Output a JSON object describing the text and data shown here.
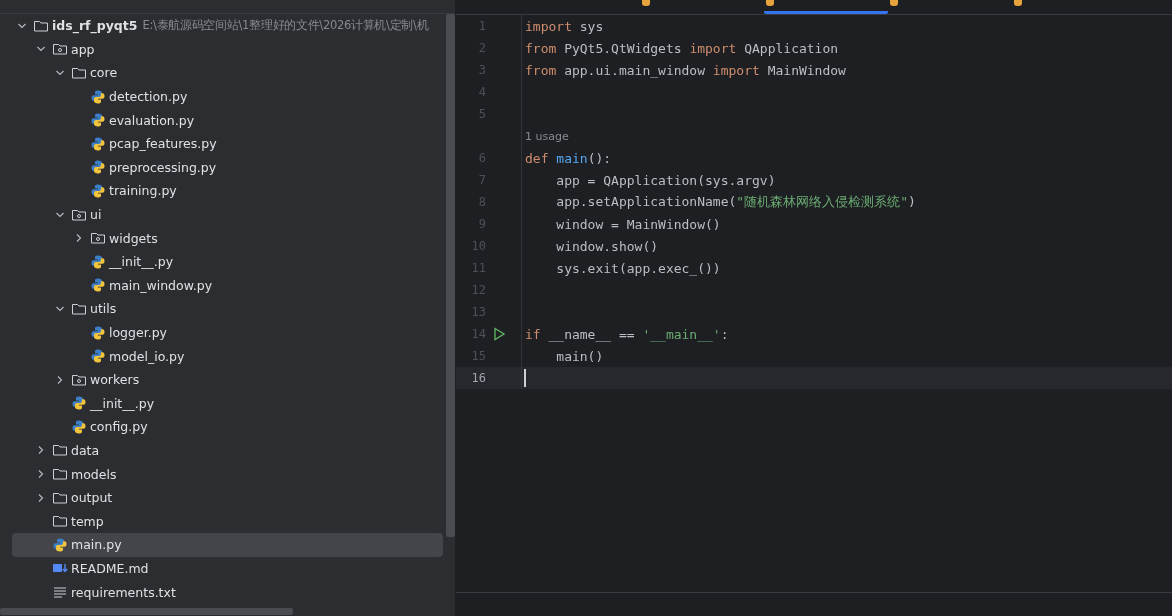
{
  "editor_tabs": [
    {
      "selected": false
    },
    {
      "selected": true
    },
    {
      "selected": false
    },
    {
      "selected": false
    }
  ],
  "project_tree": {
    "name": "ids_rf_pyqt5",
    "path": "E:\\泰航源码空间站\\1整理好的文件\\2026计算机\\定制\\机",
    "kind": "folder",
    "expanded": true,
    "selected": false,
    "children": [
      {
        "name": "app",
        "kind": "package",
        "expanded": true,
        "selected": false,
        "children": [
          {
            "name": "core",
            "kind": "folder",
            "expanded": true,
            "selected": false,
            "children": [
              {
                "name": "detection.py",
                "kind": "python",
                "selected": false
              },
              {
                "name": "evaluation.py",
                "kind": "python",
                "selected": false
              },
              {
                "name": "pcap_features.py",
                "kind": "python",
                "selected": false
              },
              {
                "name": "preprocessing.py",
                "kind": "python",
                "selected": false
              },
              {
                "name": "training.py",
                "kind": "python",
                "selected": false
              }
            ]
          },
          {
            "name": "ui",
            "kind": "package",
            "expanded": true,
            "selected": false,
            "children": [
              {
                "name": "widgets",
                "kind": "package",
                "expanded": false,
                "selected": false
              },
              {
                "name": "__init__.py",
                "kind": "python",
                "selected": false
              },
              {
                "name": "main_window.py",
                "kind": "python",
                "selected": false
              }
            ]
          },
          {
            "name": "utils",
            "kind": "folder",
            "expanded": true,
            "selected": false,
            "children": [
              {
                "name": "logger.py",
                "kind": "python",
                "selected": false
              },
              {
                "name": "model_io.py",
                "kind": "python",
                "selected": false
              }
            ]
          },
          {
            "name": "workers",
            "kind": "package",
            "expanded": false,
            "selected": false
          },
          {
            "name": "__init__.py",
            "kind": "python",
            "selected": false
          },
          {
            "name": "config.py",
            "kind": "python",
            "selected": false
          }
        ]
      },
      {
        "name": "data",
        "kind": "folder",
        "expanded": false,
        "selected": false
      },
      {
        "name": "models",
        "kind": "folder",
        "expanded": false,
        "selected": false
      },
      {
        "name": "output",
        "kind": "folder",
        "expanded": false,
        "selected": false
      },
      {
        "name": "temp",
        "kind": "folder",
        "selected": false
      },
      {
        "name": "main.py",
        "kind": "python",
        "selected": true
      },
      {
        "name": "README.md",
        "kind": "markdown",
        "selected": false
      },
      {
        "name": "requirements.txt",
        "kind": "text",
        "selected": false
      }
    ]
  },
  "editor_lines": [
    {
      "kind": "code",
      "number": "1",
      "current": false,
      "run": false,
      "tokens": [
        {
          "kind": "keyword",
          "text": "import"
        },
        {
          "kind": "plain",
          "text": " sys"
        }
      ]
    },
    {
      "kind": "code",
      "number": "2",
      "current": false,
      "run": false,
      "tokens": [
        {
          "kind": "keyword",
          "text": "from"
        },
        {
          "kind": "plain",
          "text": " PyQt5.QtWidgets "
        },
        {
          "kind": "keyword",
          "text": "import"
        },
        {
          "kind": "plain",
          "text": " QApplication"
        }
      ]
    },
    {
      "kind": "code",
      "number": "3",
      "current": false,
      "run": false,
      "tokens": [
        {
          "kind": "keyword",
          "text": "from"
        },
        {
          "kind": "plain",
          "text": " app.ui.main_window "
        },
        {
          "kind": "keyword",
          "text": "import"
        },
        {
          "kind": "plain",
          "text": " MainWindow"
        }
      ]
    },
    {
      "kind": "code",
      "number": "4",
      "current": false,
      "run": false
    },
    {
      "kind": "code",
      "number": "5",
      "current": false,
      "run": false
    },
    {
      "kind": "hint",
      "text": "1 usage"
    },
    {
      "kind": "code",
      "number": "6",
      "current": false,
      "run": false,
      "tokens": [
        {
          "kind": "keyword",
          "text": "def "
        },
        {
          "kind": "function",
          "text": "main"
        },
        {
          "kind": "plain",
          "text": "():"
        }
      ]
    },
    {
      "kind": "code",
      "number": "7",
      "current": false,
      "run": false,
      "tokens": [
        {
          "kind": "plain",
          "text": "    app = QApplication(sys.argv)"
        }
      ]
    },
    {
      "kind": "code",
      "number": "8",
      "current": false,
      "run": false,
      "tokens": [
        {
          "kind": "plain",
          "text": "    app.setApplicationName("
        },
        {
          "kind": "string",
          "text": "\"随机森林网络入侵检测系统\""
        },
        {
          "kind": "plain",
          "text": ")"
        }
      ]
    },
    {
      "kind": "code",
      "number": "9",
      "current": false,
      "run": false,
      "tokens": [
        {
          "kind": "plain",
          "text": "    window = MainWindow()"
        }
      ]
    },
    {
      "kind": "code",
      "number": "10",
      "current": false,
      "run": false,
      "tokens": [
        {
          "kind": "plain",
          "text": "    window.show()"
        }
      ]
    },
    {
      "kind": "code",
      "number": "11",
      "current": false,
      "run": false,
      "tokens": [
        {
          "kind": "plain",
          "text": "    sys.exit(app.exec_())"
        }
      ]
    },
    {
      "kind": "code",
      "number": "12",
      "current": false,
      "run": false
    },
    {
      "kind": "code",
      "number": "13",
      "current": false,
      "run": false
    },
    {
      "kind": "code",
      "number": "14",
      "current": false,
      "run": true,
      "tokens": [
        {
          "kind": "keyword",
          "text": "if"
        },
        {
          "kind": "plain",
          "text": " __name__ == "
        },
        {
          "kind": "string",
          "text": "'__main__'"
        },
        {
          "kind": "plain",
          "text": ":"
        }
      ]
    },
    {
      "kind": "code",
      "number": "15",
      "current": false,
      "run": false,
      "tokens": [
        {
          "kind": "plain",
          "text": "    main()"
        }
      ]
    },
    {
      "kind": "code",
      "number": "16",
      "current": true,
      "run": false
    }
  ]
}
